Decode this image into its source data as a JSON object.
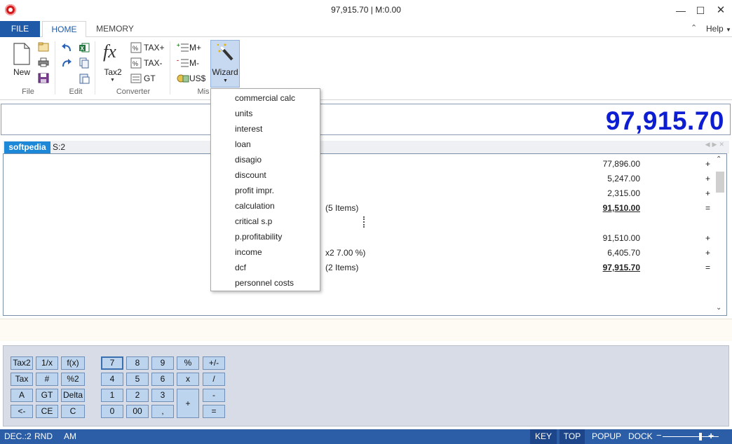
{
  "window": {
    "title": "97,915.70 | M:0.00"
  },
  "tabs": {
    "file": "FILE",
    "home": "HOME",
    "memory": "MEMORY",
    "help": "Help"
  },
  "ribbon": {
    "file_group": {
      "label": "File",
      "new": "New"
    },
    "edit_group": {
      "label": "Edit"
    },
    "converter_group": {
      "label": "Converter",
      "tax2": "Tax2",
      "tax_plus": "TAX+",
      "tax_minus": "TAX-",
      "gt": "GT"
    },
    "misc_group": {
      "label": "Mis",
      "m_plus": "M+",
      "m_minus": "M-",
      "usd": "US$",
      "wizard": "Wizard"
    }
  },
  "display": {
    "value": "97,915.70"
  },
  "sheets": {
    "active": "softpedia",
    "secondary": "S:2"
  },
  "tape": {
    "rows": [
      {
        "note": "",
        "value": "77,896.00",
        "op": "+",
        "total": false
      },
      {
        "note": "",
        "value": "5,247.00",
        "op": "+",
        "total": false
      },
      {
        "note": "",
        "value": "2,315.00",
        "op": "+",
        "total": false
      },
      {
        "note": "(5 Items)",
        "value": "91,510.00",
        "op": "=",
        "total": true
      },
      {
        "note": "",
        "value": "",
        "op": "",
        "total": false
      },
      {
        "note": "",
        "value": "91,510.00",
        "op": "+",
        "total": false
      },
      {
        "note": "x2 7.00 %)",
        "value": "6,405.70",
        "op": "+",
        "total": false
      },
      {
        "note": "(2 Items)",
        "value": "97,915.70",
        "op": "=",
        "total": true
      }
    ]
  },
  "wizard_menu": {
    "items": [
      "commercial calc",
      "units",
      "interest",
      "loan",
      "disagio",
      "discount",
      "profit impr.",
      "calculation",
      "critical s.p",
      "p.profitability",
      "income",
      "dcf",
      "personnel costs"
    ]
  },
  "keypad": {
    "left": [
      [
        "Tax2",
        "1/x",
        "f(x)"
      ],
      [
        "Tax",
        "#",
        "%2"
      ],
      [
        "A",
        "GT",
        "Delta"
      ],
      [
        "<-",
        "CE",
        "C"
      ]
    ],
    "numeric": [
      [
        "7",
        "8",
        "9",
        "%",
        "+/-"
      ],
      [
        "4",
        "5",
        "6",
        "x",
        "/"
      ],
      [
        "1",
        "2",
        "3",
        "+",
        "-"
      ],
      [
        "0",
        "00",
        ",",
        "",
        "="
      ]
    ]
  },
  "status": {
    "dec": "DEC.:2",
    "rnd": "RND",
    "am": "AM",
    "key": "KEY",
    "top": "TOP",
    "popup": "POPUP",
    "dock": "DOCK"
  },
  "colors": {
    "accent": "#1e5aa8",
    "display_text": "#0d1ed2",
    "key_face": "#bcd4ee"
  }
}
